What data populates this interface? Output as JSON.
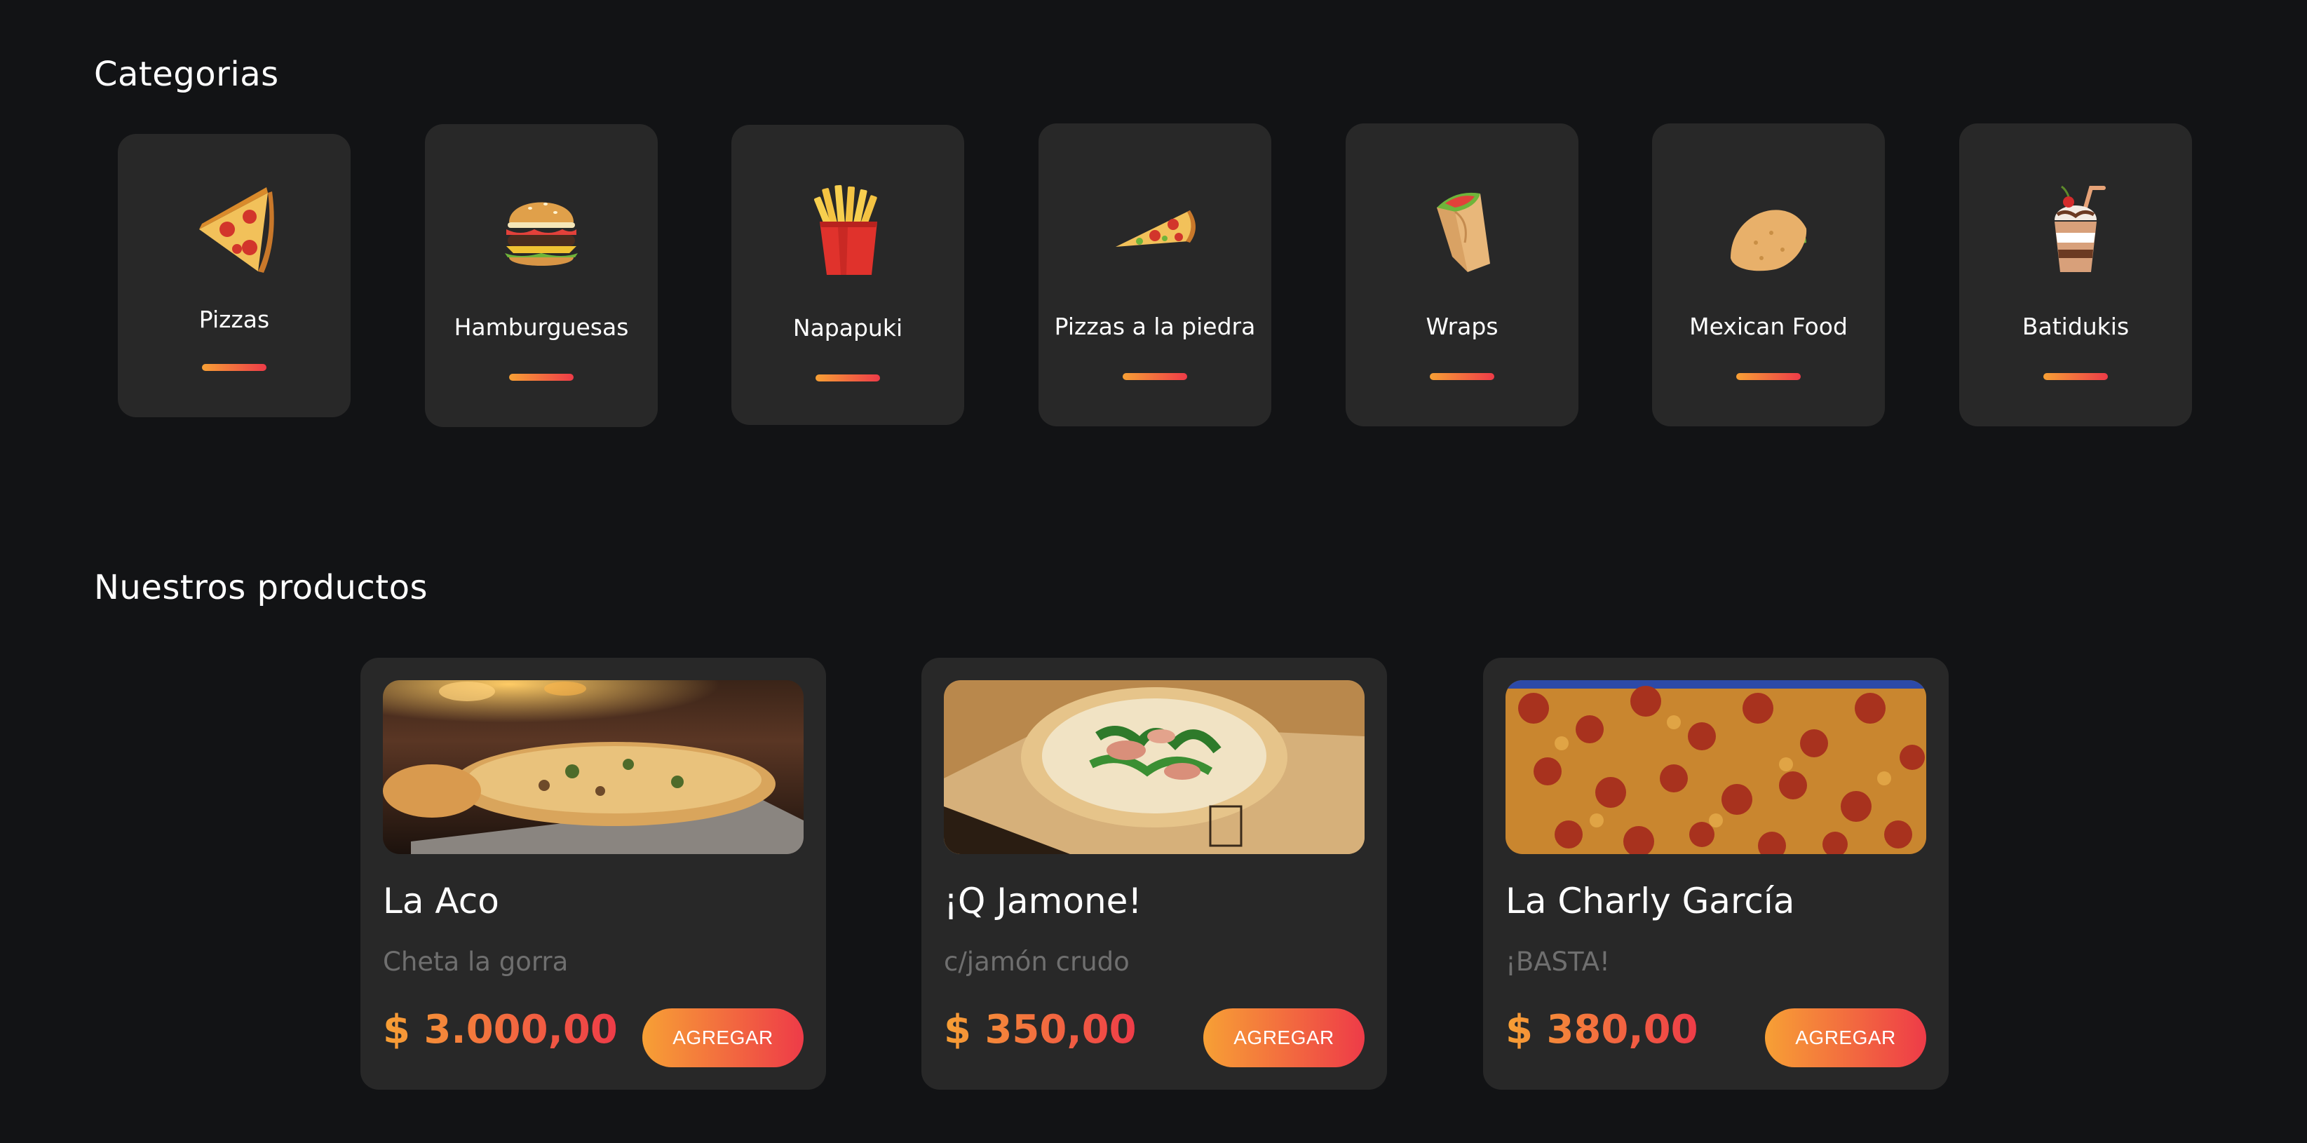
{
  "colors": {
    "background": "#121315",
    "card": "#282828",
    "accent_start": "#f7a035",
    "accent_end": "#ee3b48",
    "muted_text": "#6f6f6f"
  },
  "categories": {
    "title": "Categorias",
    "items": [
      {
        "label": "Pizzas",
        "icon": "pizza-slice-icon"
      },
      {
        "label": "Hamburguesas",
        "icon": "burger-icon"
      },
      {
        "label": "Napapuki",
        "icon": "fries-icon"
      },
      {
        "label": "Pizzas a la piedra",
        "icon": "stone-pizza-icon"
      },
      {
        "label": "Wraps",
        "icon": "wrap-icon"
      },
      {
        "label": "Mexican Food",
        "icon": "taco-icon"
      },
      {
        "label": "Batidukis",
        "icon": "milkshake-icon"
      }
    ]
  },
  "products": {
    "title": "Nuestros productos",
    "items": [
      {
        "name": "La Aco",
        "description": "Cheta la gorra",
        "price": "$ 3.000,00",
        "button": "AGREGAR",
        "image": "pizza-oven-photo"
      },
      {
        "name": "¡Q Jamone!",
        "description": "c/jamón crudo",
        "price": "$ 350,00",
        "button": "AGREGAR",
        "image": "pizza-arugula-photo"
      },
      {
        "name": "La Charly García",
        "description": "¡BASTA!",
        "price": "$ 380,00",
        "button": "AGREGAR",
        "image": "pizza-pepperoni-photo"
      }
    ]
  }
}
